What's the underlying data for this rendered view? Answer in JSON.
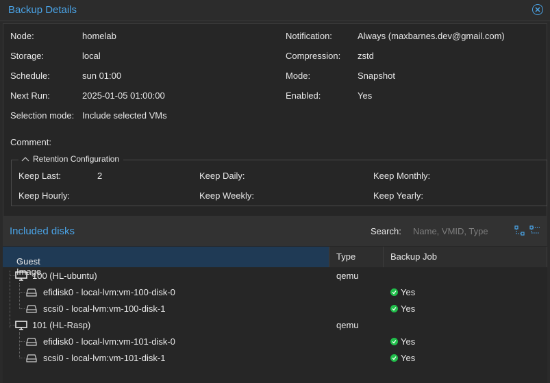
{
  "window": {
    "title": "Backup Details"
  },
  "details": {
    "left": [
      {
        "label": "Node:",
        "value": "homelab"
      },
      {
        "label": "Storage:",
        "value": "local"
      },
      {
        "label": "Schedule:",
        "value": "sun 01:00"
      },
      {
        "label": "Next Run:",
        "value": "2025-01-05 01:00:00"
      },
      {
        "label": "Selection mode:",
        "value": "Include selected VMs"
      }
    ],
    "right": [
      {
        "label": "Notification:",
        "value": "Always (maxbarnes.dev@gmail.com)"
      },
      {
        "label": "Compression:",
        "value": "zstd"
      },
      {
        "label": "Mode:",
        "value": "Snapshot"
      },
      {
        "label": "Enabled:",
        "value": "Yes"
      }
    ],
    "comment_label": "Comment:",
    "comment_value": ""
  },
  "retention": {
    "legend": "Retention Configuration",
    "keep_last_label": "Keep Last:",
    "keep_last_value": "2",
    "keep_hourly_label": "Keep Hourly:",
    "keep_hourly_value": "",
    "keep_daily_label": "Keep Daily:",
    "keep_daily_value": "",
    "keep_weekly_label": "Keep Weekly:",
    "keep_weekly_value": "",
    "keep_monthly_label": "Keep Monthly:",
    "keep_monthly_value": "",
    "keep_yearly_label": "Keep Yearly:",
    "keep_yearly_value": ""
  },
  "disks": {
    "title": "Included disks",
    "search_label": "Search:",
    "search_placeholder": "Name, VMID, Type",
    "search_value": "",
    "columns": [
      "Guest Image",
      "Type",
      "Backup Job"
    ],
    "sort_indicator": "↑",
    "rows": [
      {
        "name": "100 (HL-ubuntu)",
        "type": "qemu",
        "job": ""
      },
      {
        "name": "efidisk0 - local-lvm:vm-100-disk-0",
        "type": "",
        "job": "Yes"
      },
      {
        "name": "scsi0 - local-lvm:vm-100-disk-1",
        "type": "",
        "job": "Yes"
      },
      {
        "name": "101 (HL-Rasp)",
        "type": "qemu",
        "job": ""
      },
      {
        "name": "efidisk0 - local-lvm:vm-101-disk-0",
        "type": "",
        "job": "Yes"
      },
      {
        "name": "scsi0 - local-lvm:vm-101-disk-1",
        "type": "",
        "job": "Yes"
      }
    ]
  },
  "colors": {
    "accent": "#4aa3e6",
    "success": "#21bf4b",
    "selected_header": "#1f3a55"
  },
  "icons": [
    "close-icon",
    "collapse-icon",
    "monitor-icon",
    "disk-icon",
    "check-icon",
    "expand-tree-icon",
    "collapse-tree-icon"
  ]
}
